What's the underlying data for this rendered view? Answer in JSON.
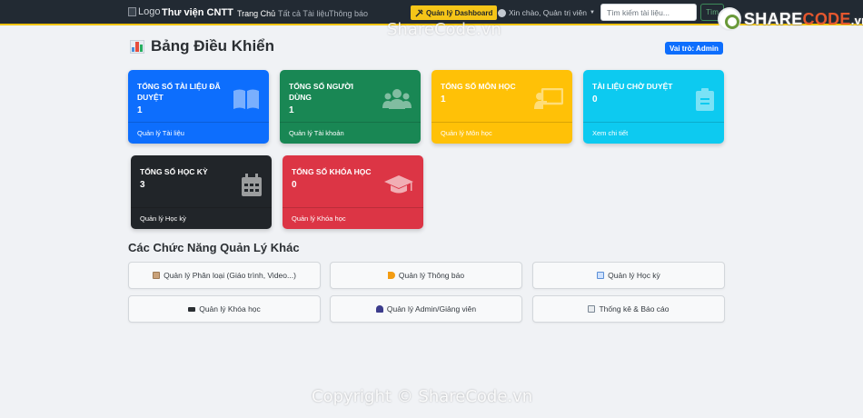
{
  "navbar": {
    "logo_alt": "Logo",
    "brand": "Thư viện CNTT",
    "links": [
      "Trang Chủ",
      "Tất cả Tài liệu",
      "Thông báo"
    ],
    "dashboard_button": "Quản lý Dashboard",
    "user_greeting": "Xin chào, Quản trị viên",
    "search_placeholder": "Tìm kiếm tài liệu...",
    "search_button": "Tìm"
  },
  "watermark": {
    "top": "ShareCode.vn",
    "logo_share": "SHARE",
    "logo_code": "CODE",
    "logo_vn": ".vn",
    "bottom": "Copyright © ShareCode.vn"
  },
  "header": {
    "title": "Bảng Điều Khiển",
    "role_badge": "Vai trò: Admin"
  },
  "cards": [
    {
      "title": "Tổng số tài liệu đã duyệt",
      "value": "1",
      "footer": "Quản lý Tài liệu",
      "icon": "book-icon",
      "color": "#0d6efd"
    },
    {
      "title": "Tổng số người dùng",
      "value": "1",
      "footer": "Quản lý Tài khoản",
      "icon": "users-icon",
      "color": "#198754"
    },
    {
      "title": "Tổng số môn học",
      "value": "1",
      "footer": "Quản lý Môn học",
      "icon": "chalkboard-icon",
      "color": "#ffc107"
    },
    {
      "title": "Tài liệu chờ duyệt",
      "value": "0",
      "footer": "Xem chi tiết",
      "icon": "clipboard-icon",
      "color": "#0dcaf0"
    },
    {
      "title": "Tổng số học kỳ",
      "value": "3",
      "footer": "Quản lý Học kỳ",
      "icon": "calendar-icon",
      "color": "#212529"
    },
    {
      "title": "Tổng số khóa học",
      "value": "0",
      "footer": "Quản lý Khóa học",
      "icon": "graduation-cap-icon",
      "color": "#dc3545"
    }
  ],
  "other_functions": {
    "title": "Các Chức Năng Quản Lý Khác",
    "buttons": [
      {
        "label": "Quản lý Phân loại (Giáo trình, Video...)",
        "icon": "category-icon"
      },
      {
        "label": "Quản lý Thông báo",
        "icon": "megaphone-icon"
      },
      {
        "label": "Quản lý Học kỳ",
        "icon": "calendar-icon"
      },
      {
        "label": "Quản lý Khóa học",
        "icon": "graduation-cap-icon"
      },
      {
        "label": "Quản lý Admin/Giảng viên",
        "icon": "user-icon"
      },
      {
        "label": "Thống kê & Báo cáo",
        "icon": "chart-icon"
      }
    ]
  }
}
